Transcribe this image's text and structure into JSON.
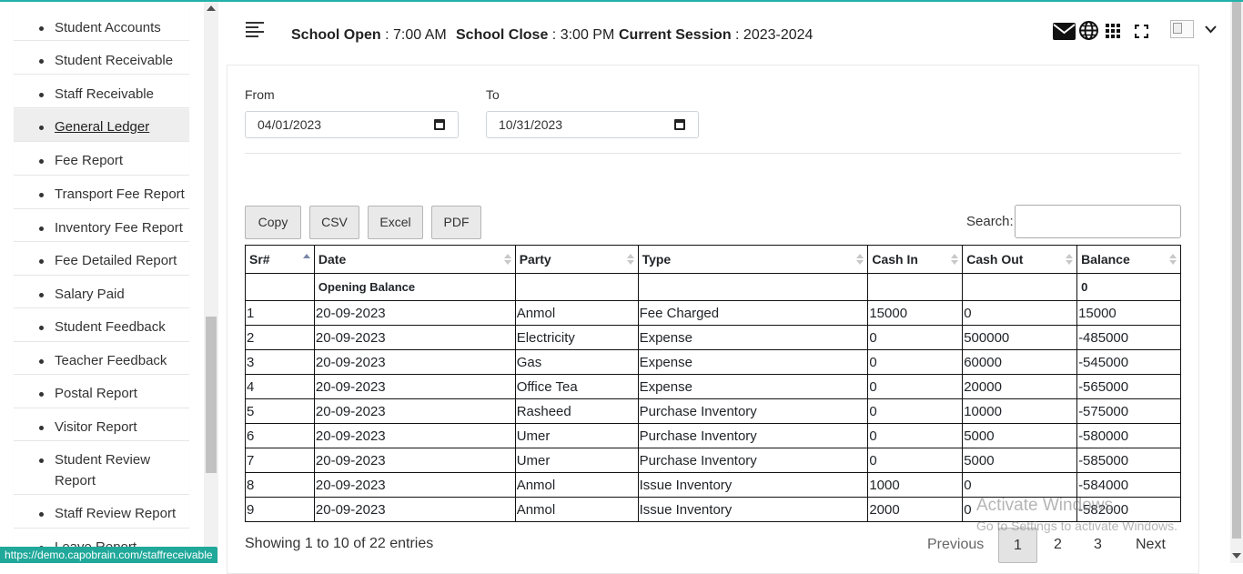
{
  "sidebar": {
    "items": [
      {
        "label": "Student Accounts"
      },
      {
        "label": "Student Receivable"
      },
      {
        "label": "Staff Receivable"
      },
      {
        "label": "General Ledger",
        "active": true
      },
      {
        "label": "Fee Report"
      },
      {
        "label": "Transport Fee Report"
      },
      {
        "label": "Inventory Fee Report"
      },
      {
        "label": "Fee Detailed Report"
      },
      {
        "label": "Salary Paid"
      },
      {
        "label": "Student Feedback"
      },
      {
        "label": "Teacher Feedback"
      },
      {
        "label": "Postal Report"
      },
      {
        "label": "Visitor Report"
      },
      {
        "label": "Student Review",
        "label2": "Report"
      },
      {
        "label": "Staff Review Report"
      },
      {
        "label": "Leave Report"
      }
    ]
  },
  "header": {
    "open_label": "School Open",
    "open_value": " : 7:00 AM",
    "close_label": "School Close",
    "close_value": " : 3:00 PM",
    "session_label": "Current Session",
    "session_value": " : 2023-2024",
    "icons": [
      "envelope-icon",
      "globe-icon",
      "grid-icon",
      "fullscreen-icon",
      "avatar",
      "chevron-down-icon"
    ]
  },
  "filters": {
    "from_label": "From",
    "from_value": "04/01/2023",
    "to_label": "To",
    "to_value": "10/31/2023"
  },
  "buttons": {
    "copy": "Copy",
    "csv": "CSV",
    "excel": "Excel",
    "pdf": "PDF"
  },
  "search": {
    "label": "Search:"
  },
  "table": {
    "headers": [
      "Sr#",
      "Date",
      "Party",
      "Type",
      "Cash In",
      "Cash Out",
      "Balance"
    ],
    "opening": {
      "label": "Opening Balance",
      "balance": "0"
    },
    "rows": [
      [
        "1",
        "20-09-2023",
        "Anmol",
        "Fee Charged",
        "15000",
        "0",
        "15000"
      ],
      [
        "2",
        "20-09-2023",
        "Electricity",
        "Expense",
        "0",
        "500000",
        "-485000"
      ],
      [
        "3",
        "20-09-2023",
        "Gas",
        "Expense",
        "0",
        "60000",
        "-545000"
      ],
      [
        "4",
        "20-09-2023",
        "Office Tea",
        "Expense",
        "0",
        "20000",
        "-565000"
      ],
      [
        "5",
        "20-09-2023",
        "Rasheed",
        "Purchase Inventory",
        "0",
        "10000",
        "-575000"
      ],
      [
        "6",
        "20-09-2023",
        "Umer",
        "Purchase Inventory",
        "0",
        "5000",
        "-580000"
      ],
      [
        "7",
        "20-09-2023",
        "Umer",
        "Purchase Inventory",
        "0",
        "5000",
        "-585000"
      ],
      [
        "8",
        "20-09-2023",
        "Anmol",
        "Issue Inventory",
        "1000",
        "0",
        "-584000"
      ],
      [
        "9",
        "20-09-2023",
        "Anmol",
        "Issue Inventory",
        "2000",
        "0",
        "-582000"
      ]
    ]
  },
  "footer": {
    "showing": "Showing 1 to 10 of 22 entries",
    "previous": "Previous",
    "pages": [
      "1",
      "2",
      "3"
    ],
    "next": "Next"
  },
  "watermark": {
    "line1": "Activate Windows",
    "line2": "Go to Settings to activate Windows."
  },
  "status_url": "https://demo.capobrain.com/staffreceivable",
  "colors": {
    "accent": "#20b2aa",
    "status_bar": "#20a89a"
  }
}
